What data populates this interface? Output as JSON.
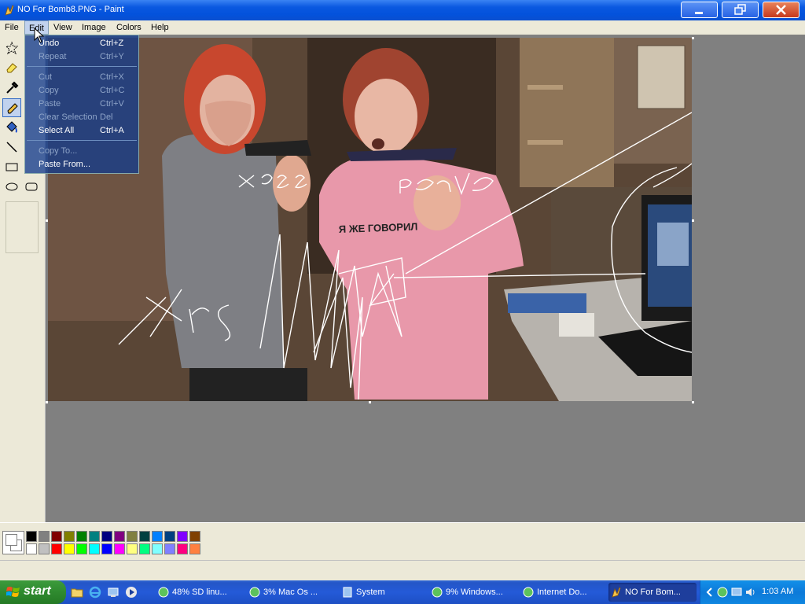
{
  "window": {
    "title": "NO For Bomb8.PNG - Paint"
  },
  "menubar": {
    "items": [
      {
        "label": "File"
      },
      {
        "label": "Edit"
      },
      {
        "label": "View"
      },
      {
        "label": "Image"
      },
      {
        "label": "Colors"
      },
      {
        "label": "Help"
      }
    ],
    "open_menu": "Edit"
  },
  "edit_menu": {
    "items": [
      {
        "label": "Undo",
        "shortcut": "Ctrl+Z",
        "enabled": true
      },
      {
        "label": "Repeat",
        "shortcut": "Ctrl+Y",
        "enabled": false
      },
      {
        "label": "Cut",
        "shortcut": "Ctrl+X",
        "enabled": false
      },
      {
        "label": "Copy",
        "shortcut": "Ctrl+C",
        "enabled": false
      },
      {
        "label": "Paste",
        "shortcut": "Ctrl+V",
        "enabled": false
      },
      {
        "label": "Clear Selection",
        "shortcut": "Del",
        "enabled": false
      },
      {
        "label": "Select All",
        "shortcut": "Ctrl+A",
        "enabled": true
      },
      {
        "label": "Copy To...",
        "shortcut": "",
        "enabled": false
      },
      {
        "label": "Paste From...",
        "shortcut": "",
        "enabled": true
      }
    ]
  },
  "toolbox": {
    "tools": [
      "free-select",
      "eraser",
      "color-picker",
      "pencil",
      "fill",
      "line",
      "rectangle",
      "ellipse",
      "rounded-rectangle"
    ],
    "selected_tool": "pencil"
  },
  "canvas": {
    "shirt_text": "Я ЖЕ ГОВОРИЛ",
    "scribbles": [
      "xpss",
      "peave",
      "xrs"
    ]
  },
  "palette": {
    "foreground": "#000000",
    "background": "#ffffff",
    "row1": [
      "#000000",
      "#808080",
      "#800000",
      "#808000",
      "#008000",
      "#008080",
      "#000080",
      "#800080",
      "#808040",
      "#004040",
      "#0080ff",
      "#004080",
      "#8000ff",
      "#804000"
    ],
    "row2": [
      "#ffffff",
      "#c0c0c0",
      "#ff0000",
      "#ffff00",
      "#00ff00",
      "#00ffff",
      "#0000ff",
      "#ff00ff",
      "#ffff80",
      "#00ff80",
      "#80ffff",
      "#8080ff",
      "#ff0080",
      "#ff8040"
    ]
  },
  "taskbar": {
    "start_label": "start",
    "tasks": [
      {
        "label": "48% SD linu...",
        "icon": "network-icon"
      },
      {
        "label": "3% Mac Os ...",
        "icon": "network-icon"
      },
      {
        "label": "System",
        "icon": "system-icon"
      },
      {
        "label": "9% Windows...",
        "icon": "network-icon"
      },
      {
        "label": "Internet Do...",
        "icon": "network-icon"
      },
      {
        "label": "NO For Bom...",
        "icon": "paint-icon",
        "active": true
      }
    ],
    "clock": "1:03 AM"
  }
}
